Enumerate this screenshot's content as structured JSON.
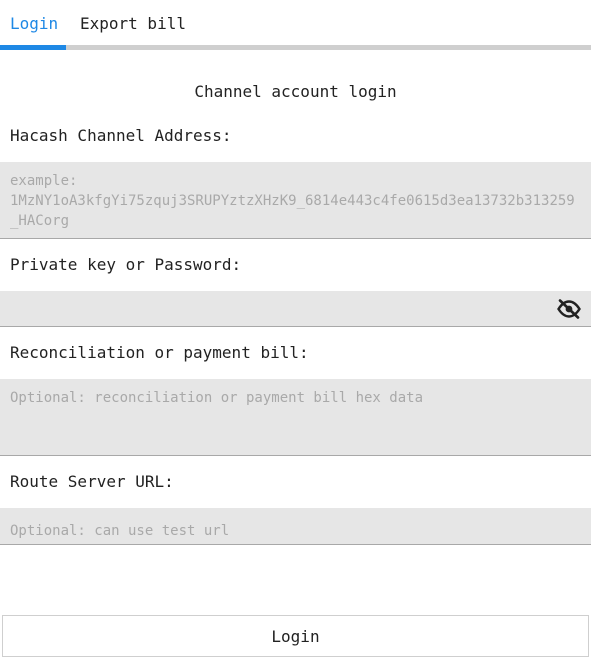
{
  "tabs": {
    "login_label": "Login",
    "export_label": "Export bill",
    "active": "Login",
    "accent_color": "#1e88e5"
  },
  "form": {
    "title": "Channel account login",
    "address": {
      "label": "Hacash Channel Address:",
      "placeholder": "example: 1MzNY1oA3kfgYi75zquj3SRUPYztzXHzK9_6814e443c4fe0615d3ea13732b313259_HACorg",
      "value": ""
    },
    "password": {
      "label": "Private key or Password:",
      "value": "",
      "toggle_icon": "eye-off-icon"
    },
    "bill": {
      "label": "Reconciliation or payment bill:",
      "placeholder": "Optional: reconciliation or payment bill hex data",
      "value": ""
    },
    "route": {
      "label": "Route Server URL:",
      "placeholder": "Optional: can use test url",
      "value": ""
    },
    "submit_label": "Login"
  }
}
